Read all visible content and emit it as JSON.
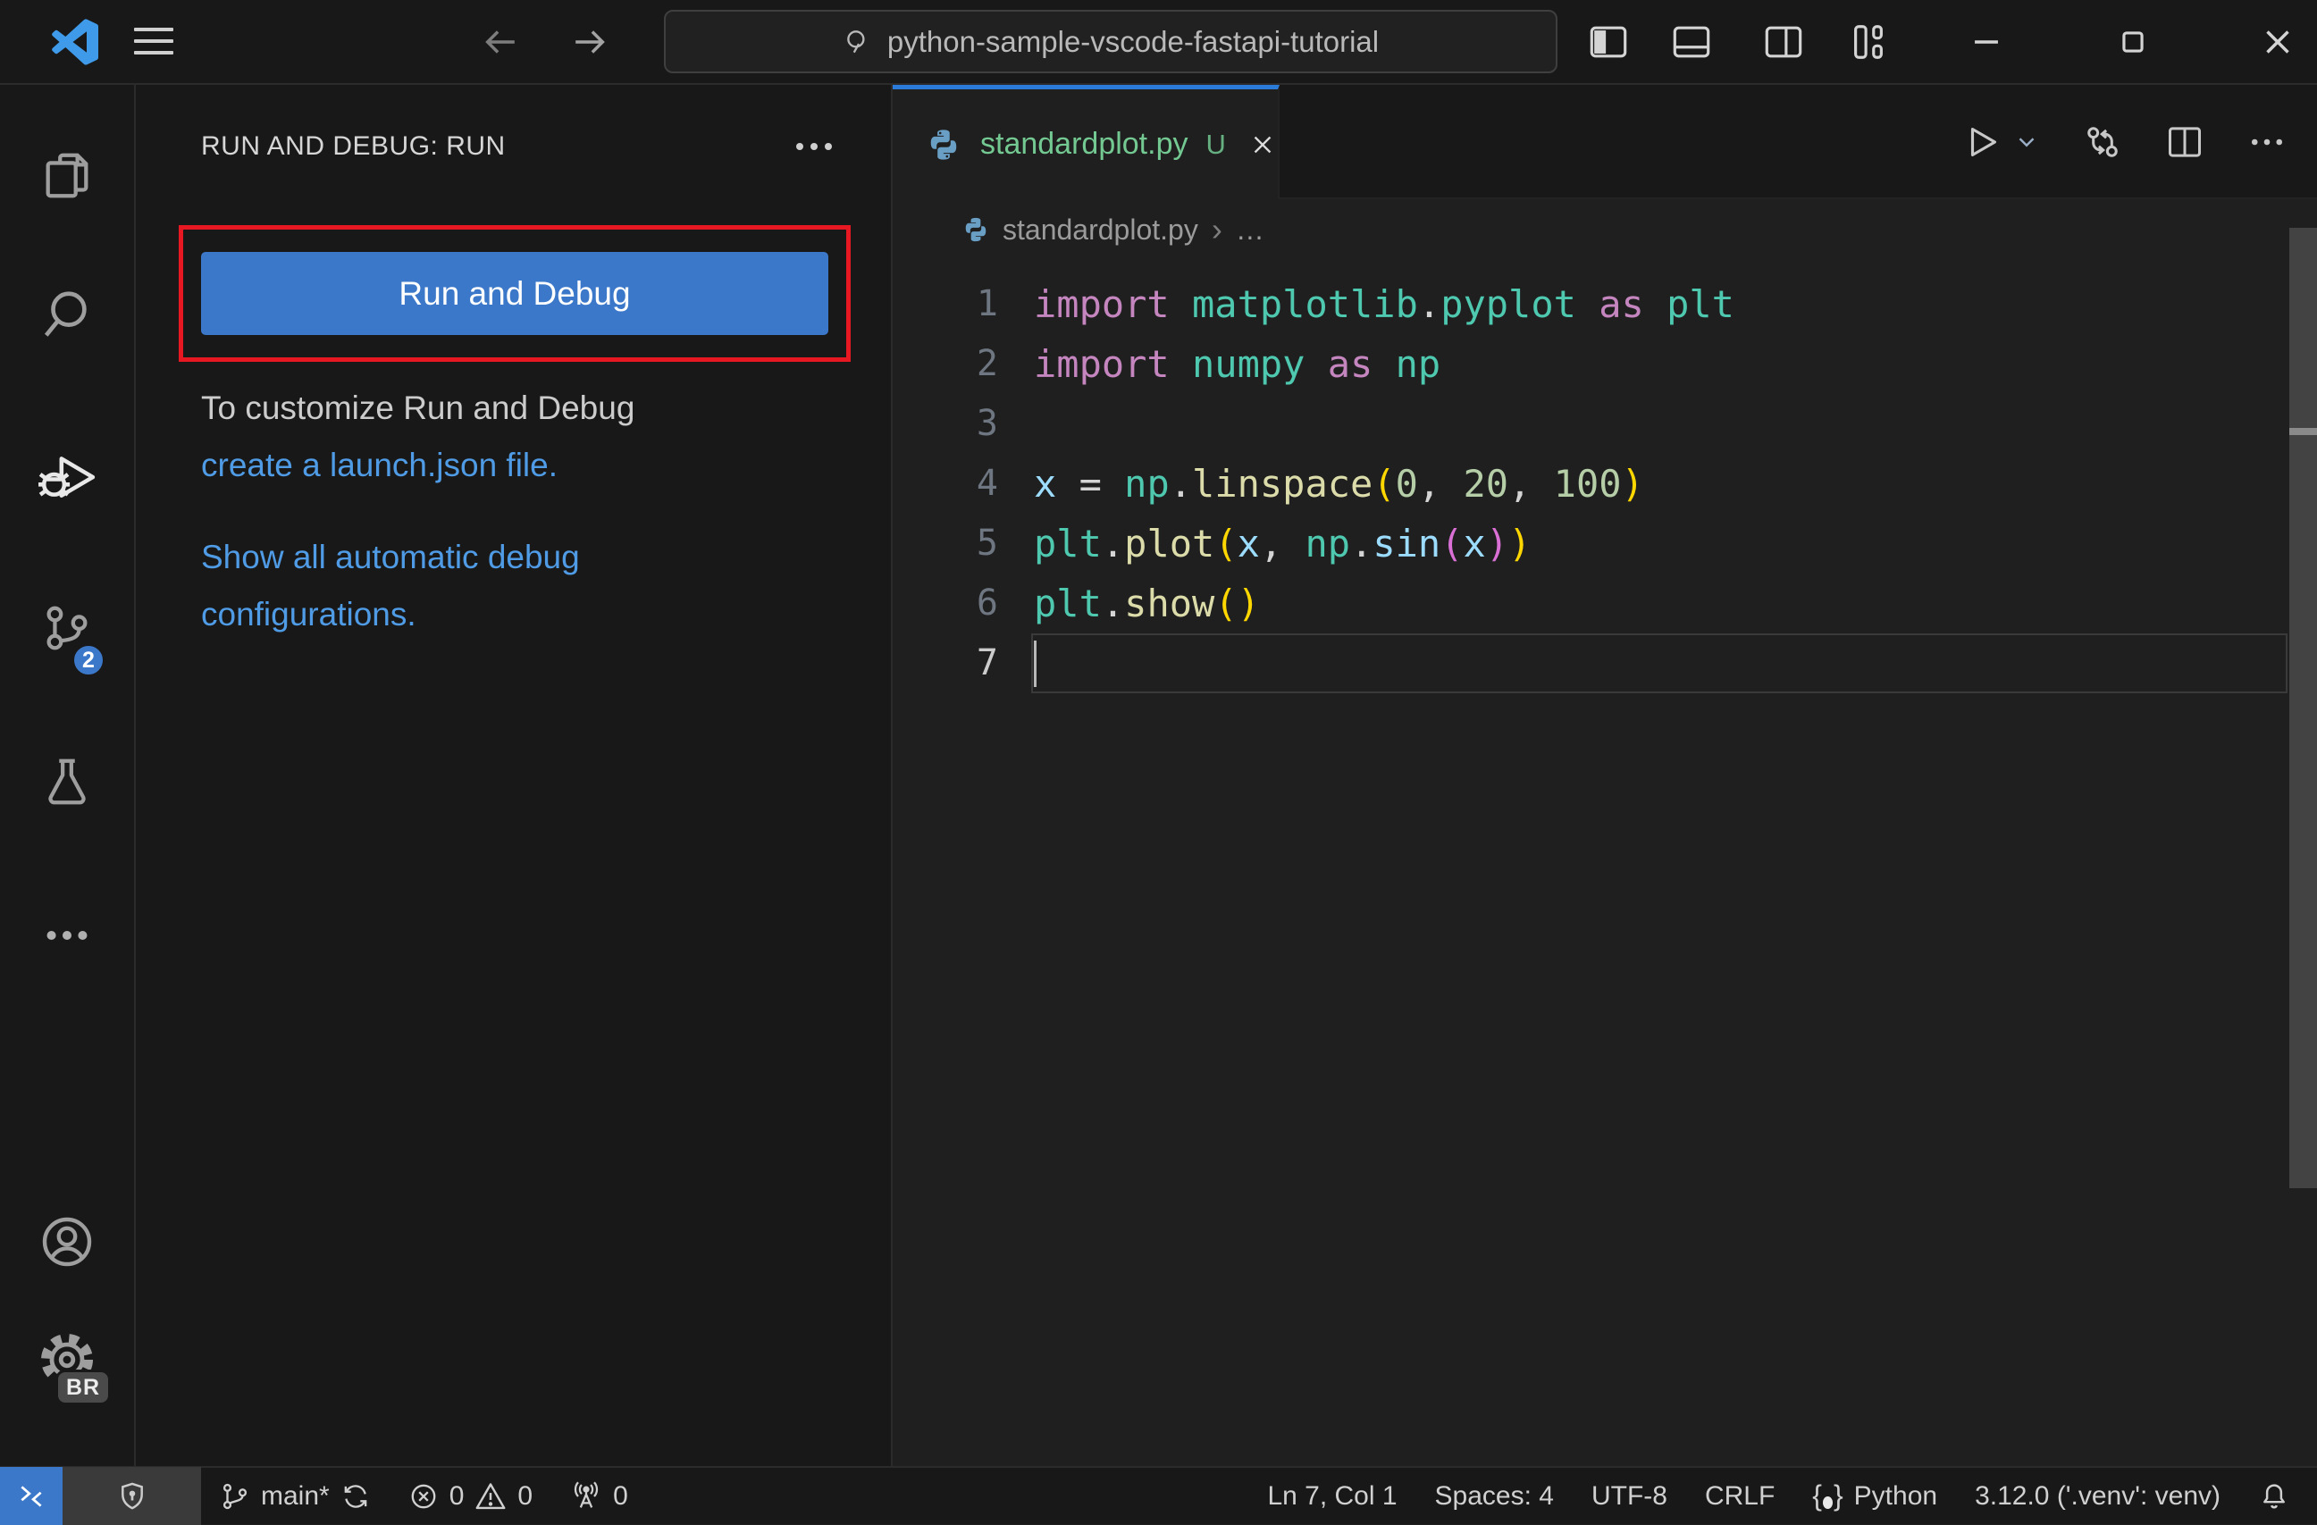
{
  "colors": {
    "panel_bg": "#181818",
    "editor_bg": "#1f1f1f",
    "accent_blue": "#3c78c9",
    "tab_active_border": "#2b7cd9",
    "link_blue": "#4f9be5",
    "annotation_red": "#e81822",
    "tab_label_green": "#73c991",
    "keyword_pink": "#c586c0",
    "type_teal": "#4ec9b0",
    "function_yellow": "#dcdcaa",
    "variable_blue": "#9cdcfe",
    "number_green": "#b5cea8",
    "bracket1_gold": "#ffd700",
    "bracket2_orchid": "#da70d6"
  },
  "title_bar": {
    "search_value": "python-sample-vscode-fastapi-tutorial"
  },
  "activity_bar": {
    "scm_badge": "2",
    "gear_badge": "BR"
  },
  "sidebar": {
    "header": "RUN AND DEBUG: RUN",
    "run_button": "Run and Debug",
    "customize_text": "To customize Run and Debug",
    "customize_link": "create a launch.json file.",
    "show_link_line1": "Show all automatic debug",
    "show_link_line2": "configurations."
  },
  "editor": {
    "tab": {
      "label": "standardplot.py",
      "modifier": "U"
    },
    "breadcrumb": {
      "file": "standardplot.py",
      "rest": "…"
    },
    "code": {
      "lines": [
        {
          "num": 1,
          "tokens": [
            {
              "c": "kw",
              "t": "import"
            },
            {
              "c": "pl",
              "t": " "
            },
            {
              "c": "type",
              "t": "matplotlib"
            },
            {
              "c": "pl",
              "t": "."
            },
            {
              "c": "type",
              "t": "pyplot"
            },
            {
              "c": "pl",
              "t": " "
            },
            {
              "c": "kw",
              "t": "as"
            },
            {
              "c": "pl",
              "t": " "
            },
            {
              "c": "type",
              "t": "plt"
            }
          ]
        },
        {
          "num": 2,
          "tokens": [
            {
              "c": "kw",
              "t": "import"
            },
            {
              "c": "pl",
              "t": " "
            },
            {
              "c": "type",
              "t": "numpy"
            },
            {
              "c": "pl",
              "t": " "
            },
            {
              "c": "kw",
              "t": "as"
            },
            {
              "c": "pl",
              "t": " "
            },
            {
              "c": "type",
              "t": "np"
            }
          ]
        },
        {
          "num": 3,
          "tokens": []
        },
        {
          "num": 4,
          "tokens": [
            {
              "c": "var",
              "t": "x"
            },
            {
              "c": "pl",
              "t": " = "
            },
            {
              "c": "type",
              "t": "np"
            },
            {
              "c": "pl",
              "t": "."
            },
            {
              "c": "fn",
              "t": "linspace"
            },
            {
              "c": "b1",
              "t": "("
            },
            {
              "c": "num",
              "t": "0"
            },
            {
              "c": "pl",
              "t": ", "
            },
            {
              "c": "num",
              "t": "20"
            },
            {
              "c": "pl",
              "t": ", "
            },
            {
              "c": "num",
              "t": "100"
            },
            {
              "c": "b1",
              "t": ")"
            }
          ]
        },
        {
          "num": 5,
          "tokens": [
            {
              "c": "type",
              "t": "plt"
            },
            {
              "c": "pl",
              "t": "."
            },
            {
              "c": "fn",
              "t": "plot"
            },
            {
              "c": "b1",
              "t": "("
            },
            {
              "c": "var",
              "t": "x"
            },
            {
              "c": "pl",
              "t": ", "
            },
            {
              "c": "type",
              "t": "np"
            },
            {
              "c": "pl",
              "t": "."
            },
            {
              "c": "var",
              "t": "sin"
            },
            {
              "c": "b2",
              "t": "("
            },
            {
              "c": "var",
              "t": "x"
            },
            {
              "c": "b2",
              "t": ")"
            },
            {
              "c": "b1",
              "t": ")"
            }
          ]
        },
        {
          "num": 6,
          "tokens": [
            {
              "c": "type",
              "t": "plt"
            },
            {
              "c": "pl",
              "t": "."
            },
            {
              "c": "fn",
              "t": "show"
            },
            {
              "c": "b1",
              "t": "("
            },
            {
              "c": "b1",
              "t": ")"
            }
          ]
        },
        {
          "num": 7,
          "tokens": []
        }
      ]
    }
  },
  "status_bar": {
    "branch": "main*",
    "errors": "0",
    "warnings": "0",
    "ports": "0",
    "cursor_position": "Ln 7, Col 1",
    "indentation": "Spaces: 4",
    "encoding": "UTF-8",
    "eol": "CRLF",
    "language": "Python",
    "interpreter": "3.12.0 ('.venv': venv)"
  }
}
